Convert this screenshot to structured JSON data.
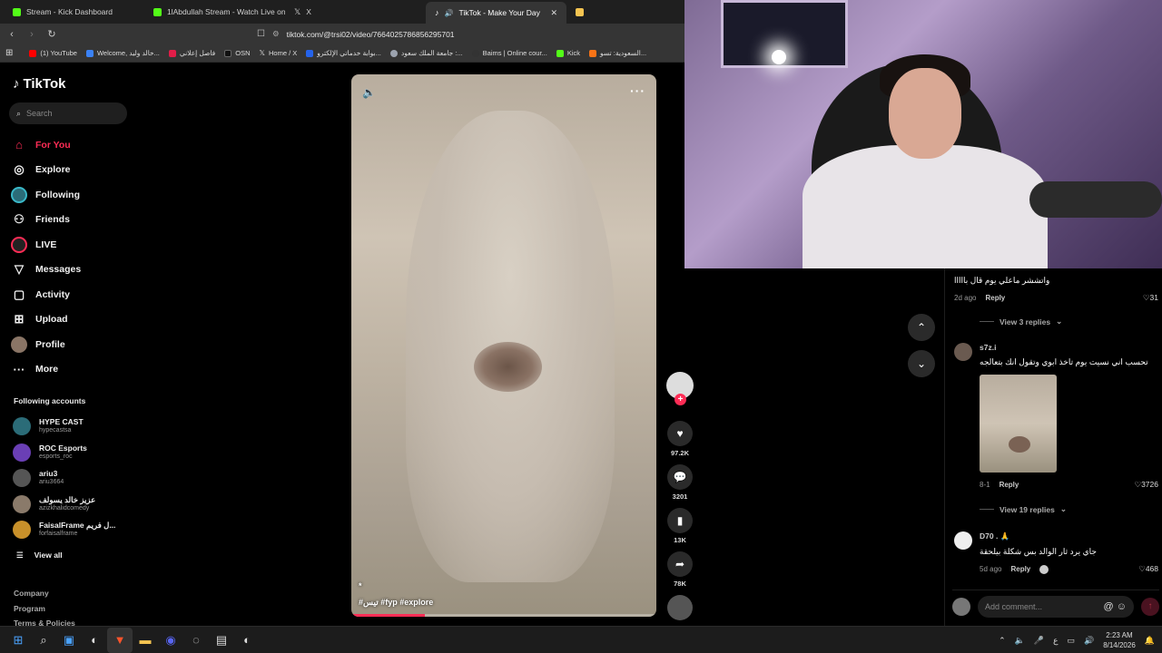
{
  "browser": {
    "tabs": [
      {
        "label": "Stream - Kick Dashboard",
        "color": "#53fc18",
        "active": false
      },
      {
        "label": "1lAbdullah Stream - Watch Live on K",
        "color": "#53fc18",
        "active": false
      },
      {
        "label": "X",
        "color": "#ffffff",
        "active": false
      },
      {
        "label": "TikTok - Make Your Day",
        "color": "#ffffff",
        "active": true
      },
      {
        "label": "",
        "color": "#f5c451",
        "active": false
      }
    ],
    "tab_close": "✕",
    "url": "tiktok.com/@trsi02/video/7664025786856295701",
    "bookmarks": [
      {
        "label": "(1) YouTube",
        "color": "#ff0000"
      },
      {
        "label": "Welcome, خالد وليد...",
        "color": "#3b82f6"
      },
      {
        "label": "فاصل إعلاني",
        "color": "#e11d48"
      },
      {
        "label": "OSN",
        "color": "#111111"
      },
      {
        "label": "Home / X",
        "color": "#ffffff"
      },
      {
        "label": "بوابة خدماتي الإلكترو...",
        "color": "#2563eb"
      },
      {
        "label": "جامعة الملك سعود :...",
        "color": "#9ca3af"
      },
      {
        "label": "Baims | Online cour...",
        "color": "#111111"
      },
      {
        "label": "Kick",
        "color": "#53fc18"
      },
      {
        "label": "السعودية: تسو...",
        "color": "#f97316"
      }
    ]
  },
  "sidebar": {
    "logo": "TikTok",
    "search_placeholder": "Search",
    "nav": [
      {
        "label": "For You",
        "icon": "home-icon",
        "glyph": "⌂",
        "active": true
      },
      {
        "label": "Explore",
        "icon": "compass-icon",
        "glyph": "◎",
        "active": false
      },
      {
        "label": "Following",
        "icon": "following-avatar-icon",
        "glyph": "◉",
        "active": false
      },
      {
        "label": "Friends",
        "icon": "friends-icon",
        "glyph": "👥",
        "active": false
      },
      {
        "label": "LIVE",
        "icon": "live-icon",
        "glyph": "◉",
        "active": false
      },
      {
        "label": "Messages",
        "icon": "messages-icon",
        "glyph": "▽",
        "active": false
      },
      {
        "label": "Activity",
        "icon": "activity-icon",
        "glyph": "▢",
        "active": false
      },
      {
        "label": "Upload",
        "icon": "upload-icon",
        "glyph": "⊞",
        "active": false
      },
      {
        "label": "Profile",
        "icon": "profile-avatar-icon",
        "glyph": "●",
        "active": false
      },
      {
        "label": "More",
        "icon": "more-icon",
        "glyph": "···",
        "active": false
      }
    ],
    "following_title": "Following accounts",
    "accounts": [
      {
        "name": "HYPE CAST",
        "handle": "hypecastsa",
        "color": "#2b6c78"
      },
      {
        "name": "ROC Esports",
        "handle": "esports_roc",
        "color": "#6a3fb5"
      },
      {
        "name": "ariu3",
        "handle": "ariu3664",
        "color": "#555555"
      },
      {
        "name": "عزيز خالد يسولف",
        "handle": "azizkhalidcomedy",
        "color": "#8a7a6a"
      },
      {
        "name": "FaisalFrame ل فريم...",
        "handle": "forfaisalframe",
        "color": "#c8902a"
      }
    ],
    "view_all": "View all",
    "footer": [
      "Company",
      "Program",
      "Terms & Policies"
    ]
  },
  "video": {
    "caption": "#تيس #fyp #explore",
    "dot": "*",
    "progress": 0.24
  },
  "actions": {
    "likes": "97.2K",
    "comments": "3201",
    "saves": "13K",
    "shares": "78K"
  },
  "comments": {
    "items": [
      {
        "user": "",
        "text": "واتششر ماعلي يوم قال بااااا",
        "age": "2d ago",
        "reply": "Reply",
        "likes": "31",
        "replies": "View 3 replies"
      },
      {
        "user": "s7z.i",
        "text": "تحسب اني نسيت يوم تاخذ ابوي وتقول انك بتعالجه",
        "age": "8-1",
        "reply": "Reply",
        "likes": "3726",
        "replies": "View 19 replies"
      },
      {
        "user": "D70 .",
        "text": "جاي يرد ثار الوالد بس شكلة بيلحقة",
        "age": "5d ago",
        "reply": "Reply",
        "likes": "468"
      }
    ],
    "add_placeholder": "Add comment..."
  },
  "taskbar": {
    "time": "2:23 AM",
    "date": "8/14/2026"
  }
}
